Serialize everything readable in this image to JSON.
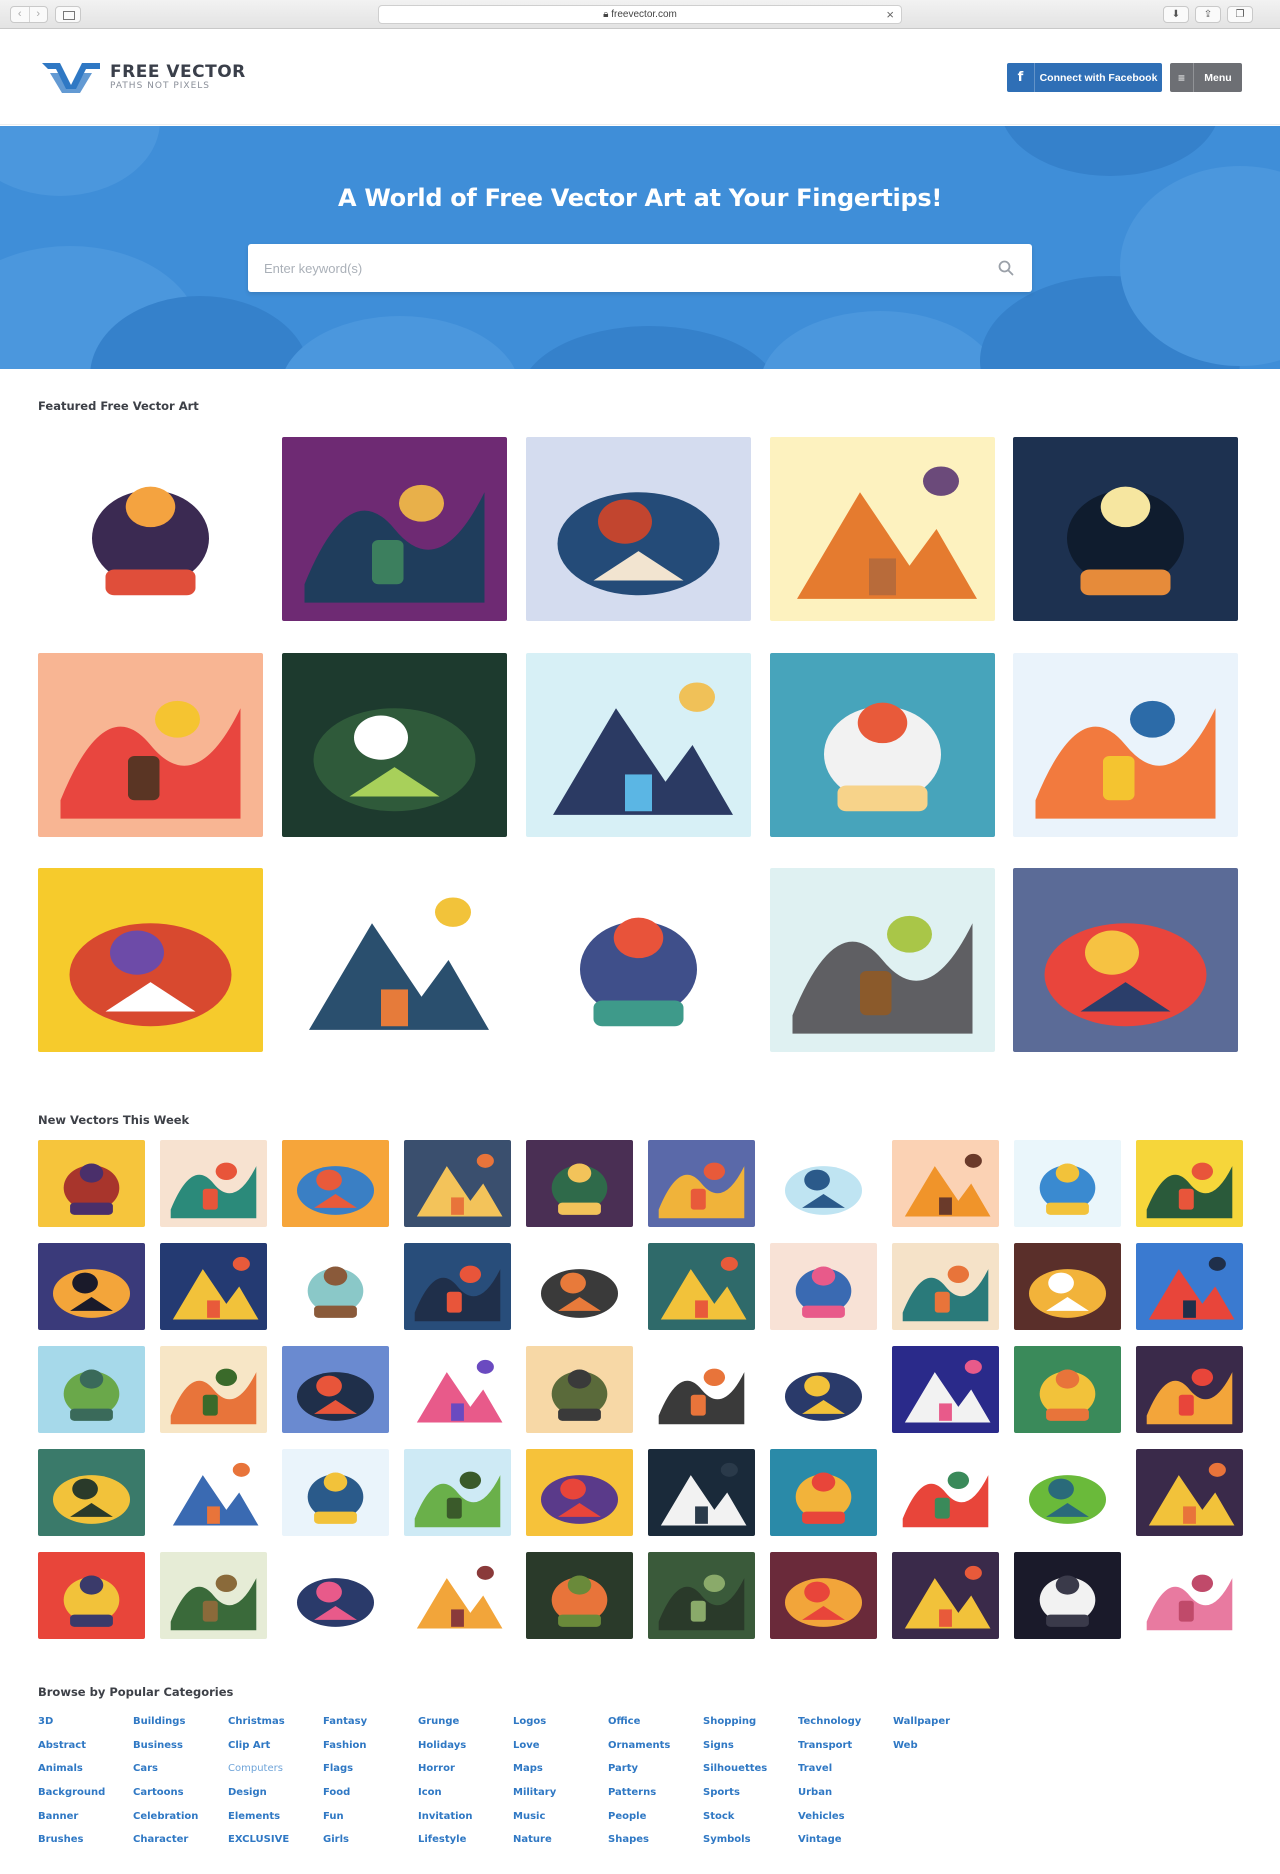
{
  "browser": {
    "url": "freevector.com"
  },
  "header": {
    "logo_title": "FREE VECTOR",
    "logo_tagline": "PATHS NOT PIXELS",
    "facebook_label": "Connect with Facebook",
    "menu_label": "Menu"
  },
  "hero": {
    "headline": "A World of Free Vector Art at Your Fingertips!",
    "search_placeholder": "Enter keyword(s)",
    "search_value": ""
  },
  "featured": {
    "title": "Featured Free Vector Art",
    "items": [
      {
        "bg": "#ffffff",
        "c1": "#3b2a52",
        "c2": "#f4a340",
        "c3": "#e04e3a"
      },
      {
        "bg": "#6e2a73",
        "c1": "#1f3d5c",
        "c2": "#e8b04a",
        "c3": "#3c7f5e"
      },
      {
        "bg": "#d4dcef",
        "c1": "#244b78",
        "c2": "#c2452f",
        "c3": "#f2e4d0"
      },
      {
        "bg": "#fdf2bf",
        "c1": "#e57b2f",
        "c2": "#6b4a7a",
        "c3": "#b86b3a"
      },
      {
        "bg": "#1d3150",
        "c1": "#0f1c2e",
        "c2": "#f6e6a0",
        "c3": "#e68b3a"
      },
      {
        "bg": "#f8b593",
        "c1": "#e8463f",
        "c2": "#f5c431",
        "c3": "#5a3524"
      },
      {
        "bg": "#1d3a2e",
        "c1": "#2f5a3a",
        "c2": "#ffffff",
        "c3": "#a8d05a"
      },
      {
        "bg": "#d7f0f6",
        "c1": "#2b3a63",
        "c2": "#f0c158",
        "c3": "#5bb6e4"
      },
      {
        "bg": "#47a4bb",
        "c1": "#f2f2f2",
        "c2": "#e85a3a",
        "c3": "#f7d38a"
      },
      {
        "bg": "#eaf3fb",
        "c1": "#f27a3e",
        "c2": "#2c6ba8",
        "c3": "#f4c430"
      },
      {
        "bg": "#f6cb2c",
        "c1": "#d8492f",
        "c2": "#6d4ba8",
        "c3": "#ffffff"
      },
      {
        "bg": "#ffffff",
        "c1": "#2a4f6e",
        "c2": "#f2c33a",
        "c3": "#e67b3a"
      },
      {
        "bg": "#ffffff",
        "c1": "#3f4f8a",
        "c2": "#e8533a",
        "c3": "#3e9a8a"
      },
      {
        "bg": "#dff1f2",
        "c1": "#5f5f63",
        "c2": "#a9c648",
        "c3": "#8b5a2b"
      },
      {
        "bg": "#5b6b97",
        "c1": "#e9453c",
        "c2": "#f6c242",
        "c3": "#2b3e6a"
      }
    ]
  },
  "new_vectors": {
    "title": "New Vectors This Week",
    "items": [
      {
        "bg": "#f6c53c",
        "c1": "#a8352c",
        "c2": "#4a2f6a"
      },
      {
        "bg": "#f7e2d0",
        "c1": "#2b8a7a",
        "c2": "#e8553a"
      },
      {
        "bg": "#f6a53a",
        "c1": "#3a7fc4",
        "c2": "#e85a3a"
      },
      {
        "bg": "#3a4f6e",
        "c1": "#f3c35a",
        "c2": "#e8743a"
      },
      {
        "bg": "#4a2f54",
        "c1": "#2f6a4a",
        "c2": "#f2c35a"
      },
      {
        "bg": "#5a69a9",
        "c1": "#f0b33a",
        "c2": "#e85a3a"
      },
      {
        "bg": "#ffffff",
        "c1": "#bfe4f2",
        "c2": "#2b5a8a"
      },
      {
        "bg": "#fbd2b4",
        "c1": "#f0942a",
        "c2": "#6a3a2a"
      },
      {
        "bg": "#eaf6fb",
        "c1": "#3a8ad0",
        "c2": "#f2c23a"
      },
      {
        "bg": "#f6d63a",
        "c1": "#2a5a3a",
        "c2": "#e8553a"
      },
      {
        "bg": "#3a3a7a",
        "c1": "#f3a53a",
        "c2": "#1a1a2a"
      },
      {
        "bg": "#243a72",
        "c1": "#f2c23a",
        "c2": "#e85a3a"
      },
      {
        "bg": "#ffffff",
        "c1": "#8ac8c8",
        "c2": "#8a5a3a"
      },
      {
        "bg": "#284d7a",
        "c1": "#1f2f4a",
        "c2": "#e8553a"
      },
      {
        "bg": "#ffffff",
        "c1": "#3a3a3a",
        "c2": "#e87a3a"
      },
      {
        "bg": "#2f6a6a",
        "c1": "#f2c23a",
        "c2": "#e85a3a"
      },
      {
        "bg": "#f8e2d6",
        "c1": "#3a6ab2",
        "c2": "#e85a8a"
      },
      {
        "bg": "#f5e2c8",
        "c1": "#2a7a7a",
        "c2": "#e8743a"
      },
      {
        "bg": "#5a2f2a",
        "c1": "#f2b33a",
        "c2": "#ffffff"
      },
      {
        "bg": "#3a7ad0",
        "c1": "#e8453a",
        "c2": "#1f2f4a"
      },
      {
        "bg": "#a6d9ea",
        "c1": "#6aa84a",
        "c2": "#3a6a5a"
      },
      {
        "bg": "#f7e6c6",
        "c1": "#e8743a",
        "c2": "#3a6a2a"
      },
      {
        "bg": "#6a8ad0",
        "c1": "#1f2f4a",
        "c2": "#e8553a"
      },
      {
        "bg": "#ffffff",
        "c1": "#e85a8a",
        "c2": "#6a4ac0"
      },
      {
        "bg": "#f7d8a6",
        "c1": "#5a6a3a",
        "c2": "#3a3a3a"
      },
      {
        "bg": "#ffffff",
        "c1": "#3a3a3a",
        "c2": "#e8743a"
      },
      {
        "bg": "#ffffff",
        "c1": "#2a3a6a",
        "c2": "#f2c23a"
      },
      {
        "bg": "#2a2a8a",
        "c1": "#f2f2f2",
        "c2": "#e85a8a"
      },
      {
        "bg": "#3a8a5a",
        "c1": "#f2c23a",
        "c2": "#e8743a"
      },
      {
        "bg": "#3a2a4a",
        "c1": "#f3a53a",
        "c2": "#e8453a"
      },
      {
        "bg": "#3a7a6a",
        "c1": "#f2c23a",
        "c2": "#2a3a2a"
      },
      {
        "bg": "#ffffff",
        "c1": "#3a6ab2",
        "c2": "#e8743a"
      },
      {
        "bg": "#eaf4fb",
        "c1": "#2a5a8a",
        "c2": "#f2c23a"
      },
      {
        "bg": "#ceeaf5",
        "c1": "#6ab04a",
        "c2": "#3a5a2a"
      },
      {
        "bg": "#f6c23a",
        "c1": "#5a3a8a",
        "c2": "#e8453a"
      },
      {
        "bg": "#1a2a3a",
        "c1": "#f2f2f2",
        "c2": "#2a3a4a"
      },
      {
        "bg": "#2a8aa8",
        "c1": "#f2b33a",
        "c2": "#e8453a"
      },
      {
        "bg": "#ffffff",
        "c1": "#e8453a",
        "c2": "#3a8a5a"
      },
      {
        "bg": "#ffffff",
        "c1": "#6aba3a",
        "c2": "#2a6a7a"
      },
      {
        "bg": "#3a2a4a",
        "c1": "#f2c23a",
        "c2": "#e8743a"
      },
      {
        "bg": "#e8453a",
        "c1": "#f2c23a",
        "c2": "#3a3a6a"
      },
      {
        "bg": "#e6ecd6",
        "c1": "#3a6a3a",
        "c2": "#8a6a3a"
      },
      {
        "bg": "#ffffff",
        "c1": "#2a3a6a",
        "c2": "#e85a8a"
      },
      {
        "bg": "#ffffff",
        "c1": "#f2a53a",
        "c2": "#8a3a3a"
      },
      {
        "bg": "#2a3a2a",
        "c1": "#e8743a",
        "c2": "#6a8a3a"
      },
      {
        "bg": "#3a5a3a",
        "c1": "#2a3a2a",
        "c2": "#8aaa6a"
      },
      {
        "bg": "#6a2a3a",
        "c1": "#f2a53a",
        "c2": "#e8453a"
      },
      {
        "bg": "#3a2a4a",
        "c1": "#f2c23a",
        "c2": "#e85a3a"
      },
      {
        "bg": "#1a1a2a",
        "c1": "#f2f2f2",
        "c2": "#3a3a4a"
      },
      {
        "bg": "#ffffff",
        "c1": "#e87aa0",
        "c2": "#c04a6a"
      }
    ]
  },
  "categories": {
    "title": "Browse by Popular Categories",
    "columns": [
      [
        "3D",
        "Abstract",
        "Animals",
        "Background",
        "Banner",
        "Brushes"
      ],
      [
        "Buildings",
        "Business",
        "Cars",
        "Cartoons",
        "Celebration",
        "Character"
      ],
      [
        "Christmas",
        "Clip Art",
        "Computers",
        "Design",
        "Elements",
        "EXCLUSIVE"
      ],
      [
        "Fantasy",
        "Fashion",
        "Flags",
        "Food",
        "Fun",
        "Girls"
      ],
      [
        "Grunge",
        "Holidays",
        "Horror",
        "Icon",
        "Invitation",
        "Lifestyle"
      ],
      [
        "Logos",
        "Love",
        "Maps",
        "Military",
        "Music",
        "Nature"
      ],
      [
        "Office",
        "Ornaments",
        "Party",
        "Patterns",
        "People",
        "Shapes"
      ],
      [
        "Shopping",
        "Signs",
        "Silhouettes",
        "Sports",
        "Stock",
        "Symbols"
      ],
      [
        "Technology",
        "Transport",
        "Travel",
        "Urban",
        "Vehicles",
        "Vintage"
      ],
      [
        "Wallpaper",
        "Web"
      ]
    ]
  },
  "colors": {
    "accent": "#2f78c4",
    "hero_bg": "#3f8ed8",
    "facebook": "#2f6fb6",
    "menu": "#6d6f74"
  }
}
